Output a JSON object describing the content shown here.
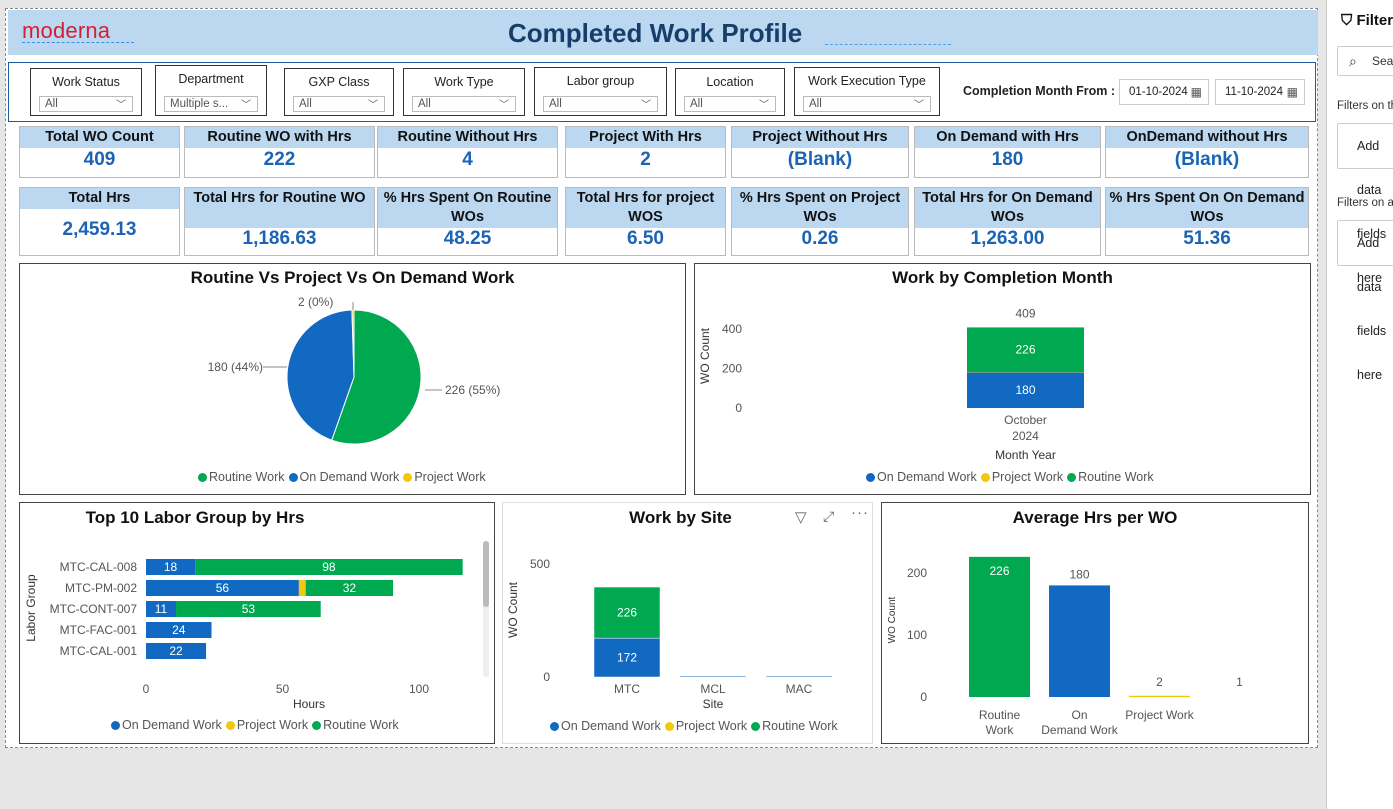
{
  "header": {
    "logo": "moderna",
    "title": "Completed Work Profile"
  },
  "filters": {
    "slicers": [
      {
        "label": "Work Status",
        "value": "All"
      },
      {
        "label": "Department",
        "value": "Multiple s..."
      },
      {
        "label": "GXP Class",
        "value": "All"
      },
      {
        "label": "Work Type",
        "value": "All"
      },
      {
        "label": "Labor group",
        "value": "All"
      },
      {
        "label": "Location",
        "value": "All"
      },
      {
        "label": "Work Execution Type",
        "value": "All"
      }
    ],
    "completion_label": "Completion Month From :",
    "date_from": "01-10-2024",
    "date_to": "11-10-2024"
  },
  "kpi_row1": [
    {
      "label": "Total WO Count",
      "value": "409"
    },
    {
      "label": "Routine WO with Hrs",
      "value": "222"
    },
    {
      "label": "Routine Without Hrs",
      "value": "4"
    },
    {
      "label": "Project With Hrs",
      "value": "2"
    },
    {
      "label": "Project Without Hrs",
      "value": "(Blank)"
    },
    {
      "label": "On Demand with Hrs",
      "value": "180"
    },
    {
      "label": "OnDemand without Hrs",
      "value": "(Blank)"
    }
  ],
  "kpi_row2": [
    {
      "label": "Total Hrs",
      "value": "2,459.13"
    },
    {
      "label": "Total Hrs for Routine WO",
      "value": "1,186.63"
    },
    {
      "label": "% Hrs Spent On Routine WOs",
      "value": "48.25"
    },
    {
      "label": "Total Hrs for project WOS",
      "value": "6.50"
    },
    {
      "label": "% Hrs Spent on Project WOs",
      "value": "0.26"
    },
    {
      "label": "Total Hrs for On Demand WOs",
      "value": "1,263.00"
    },
    {
      "label": "% Hrs Spent On On Demand WOs",
      "value": "51.36"
    }
  ],
  "colors": {
    "routine": "#00a84f",
    "ondemand": "#1269c2",
    "project": "#f2c80f",
    "header_bg": "#bcd8f1",
    "kpi_value": "#1b64b5",
    "logo": "#d21f35"
  },
  "sidebar": {
    "title": "Filters",
    "search": "Search",
    "sec1": "Filters on this visual",
    "sec2": "Filters on all pages",
    "add": "Add data fields here"
  },
  "chart_data": [
    {
      "type": "pie",
      "title": "Routine Vs Project Vs On Demand Work",
      "slices": [
        {
          "name": "Routine Work",
          "value": 226,
          "label": "226 (55%)"
        },
        {
          "name": "On Demand Work",
          "value": 180,
          "label": "180 (44%)"
        },
        {
          "name": "Project Work",
          "value": 2,
          "label": "2 (0%)"
        }
      ],
      "legend": [
        "Routine Work",
        "On Demand Work",
        "Project Work"
      ]
    },
    {
      "type": "bar",
      "title": "Work by Completion Month",
      "xlabel": "Month Year",
      "ylabel": "WO Count",
      "categories": [
        "October 2024"
      ],
      "series": [
        {
          "name": "On Demand Work",
          "values": [
            180
          ]
        },
        {
          "name": "Project Work",
          "values": [
            2
          ]
        },
        {
          "name": "Routine Work",
          "values": [
            226
          ]
        }
      ],
      "totals": [
        409
      ],
      "yticks": [
        "0",
        "200",
        "400"
      ],
      "ylim": [
        0,
        409
      ],
      "legend": [
        "On Demand Work",
        "Project Work",
        "Routine Work"
      ]
    },
    {
      "type": "bar",
      "orientation": "horizontal",
      "title": "Top 10 Labor Group by Hrs",
      "xlabel": "Hours",
      "ylabel": "Labor Group",
      "categories": [
        "MTC-CAL-008",
        "MTC-PM-002",
        "MTC-CONT-007",
        "MTC-FAC-001",
        "MTC-CAL-001"
      ],
      "series": [
        {
          "name": "On Demand Work",
          "values": [
            18,
            56,
            11,
            24,
            22
          ]
        },
        {
          "name": "Project Work",
          "values": [
            0,
            2.5,
            0,
            0,
            0
          ]
        },
        {
          "name": "Routine Work",
          "values": [
            98,
            32,
            53,
            0,
            0
          ]
        }
      ],
      "xticks": [
        "0",
        "50",
        "100"
      ],
      "xlim": [
        0,
        120
      ],
      "legend": [
        "On Demand Work",
        "Project Work",
        "Routine Work"
      ]
    },
    {
      "type": "bar",
      "title": "Work by Site",
      "xlabel": "Site",
      "ylabel": "WO Count",
      "categories": [
        "MTC",
        "MCL",
        "MAC"
      ],
      "series": [
        {
          "name": "On Demand Work",
          "values": [
            172,
            4,
            1
          ]
        },
        {
          "name": "Project Work",
          "values": [
            0,
            0,
            0
          ]
        },
        {
          "name": "Routine Work",
          "values": [
            226,
            0,
            0
          ]
        }
      ],
      "yticks": [
        "0",
        "500"
      ],
      "ylim": [
        0,
        500
      ],
      "legend": [
        "On Demand Work",
        "Project Work",
        "Routine Work"
      ]
    },
    {
      "type": "bar",
      "title": "Average Hrs per WO",
      "ylabel": "WO Count",
      "categories": [
        "Routine Work",
        "On Demand Work",
        "Project Work",
        ""
      ],
      "values": [
        226,
        180,
        2,
        1
      ],
      "labels": [
        "226",
        "180",
        "2",
        "1"
      ],
      "yticks": [
        "0",
        "100",
        "200"
      ],
      "ylim": [
        0,
        240
      ]
    }
  ]
}
